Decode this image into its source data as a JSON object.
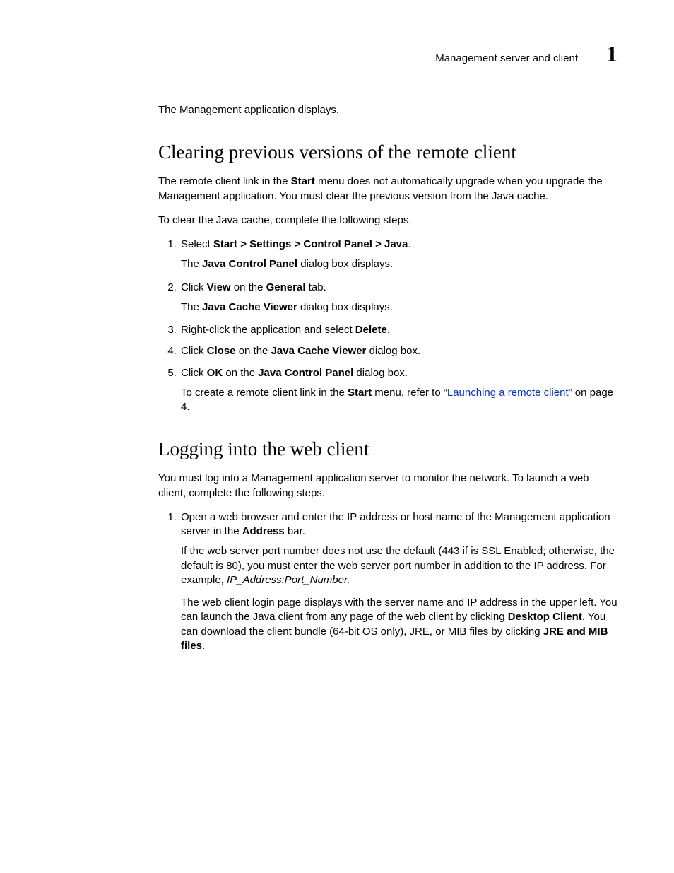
{
  "header": {
    "running_title": "Management server and client",
    "chapter_number": "1"
  },
  "intro": {
    "line": "The Management application displays."
  },
  "section1": {
    "title": "Clearing previous versions of the remote client",
    "para1_a": "The remote client link in the ",
    "para1_b": "Start",
    "para1_c": " menu does not automatically upgrade when you upgrade the Management application. You must clear the previous version from the Java cache.",
    "para2": "To clear the Java cache, complete the following steps.",
    "step1_a": "Select ",
    "step1_b": "Start > Settings > Control Panel > Java",
    "step1_c": ".",
    "step1_sub_a": "The ",
    "step1_sub_b": "Java Control Panel",
    "step1_sub_c": " dialog box displays.",
    "step2_a": "Click ",
    "step2_b": "View",
    "step2_c": " on the ",
    "step2_d": "General",
    "step2_e": " tab.",
    "step2_sub_a": "The ",
    "step2_sub_b": "Java Cache Viewer",
    "step2_sub_c": " dialog box displays.",
    "step3_a": "Right-click the application and select ",
    "step3_b": "Delete",
    "step3_c": ".",
    "step4_a": "Click ",
    "step4_b": "Close",
    "step4_c": " on the ",
    "step4_d": "Java Cache Viewer",
    "step4_e": " dialog box.",
    "step5_a": "Click ",
    "step5_b": "OK",
    "step5_c": " on the ",
    "step5_d": "Java Control Panel",
    "step5_e": " dialog box.",
    "step5_sub_a": "To create a remote client link in the ",
    "step5_sub_b": "Start",
    "step5_sub_c": " menu, refer to ",
    "step5_sub_link": "“Launching a remote client”",
    "step5_sub_d": " on page 4."
  },
  "section2": {
    "title": "Logging into the web client",
    "para1": "You must log into a Management application server to monitor the network. To launch a web client, complete the following steps.",
    "step1_a": "Open a web browser and enter the IP address or host name of the Management application server in the ",
    "step1_b": "Address",
    "step1_c": " bar.",
    "step1_sub1_a": "If the web server port number does not use the default (443 if is SSL Enabled; otherwise, the default is 80), you must enter the web server port number in addition to the IP address. For example, ",
    "step1_sub1_b": "IP_Address:Port_Number.",
    "step1_sub2_a": "The web client login page displays with the server name and IP address in the upper left. You can launch the Java client from any page of the web client by clicking ",
    "step1_sub2_b": "Desktop Client",
    "step1_sub2_c": ". You can download the client bundle (64-bit OS only), JRE, or MIB files by clicking ",
    "step1_sub2_d": "JRE and MIB files",
    "step1_sub2_e": "."
  }
}
